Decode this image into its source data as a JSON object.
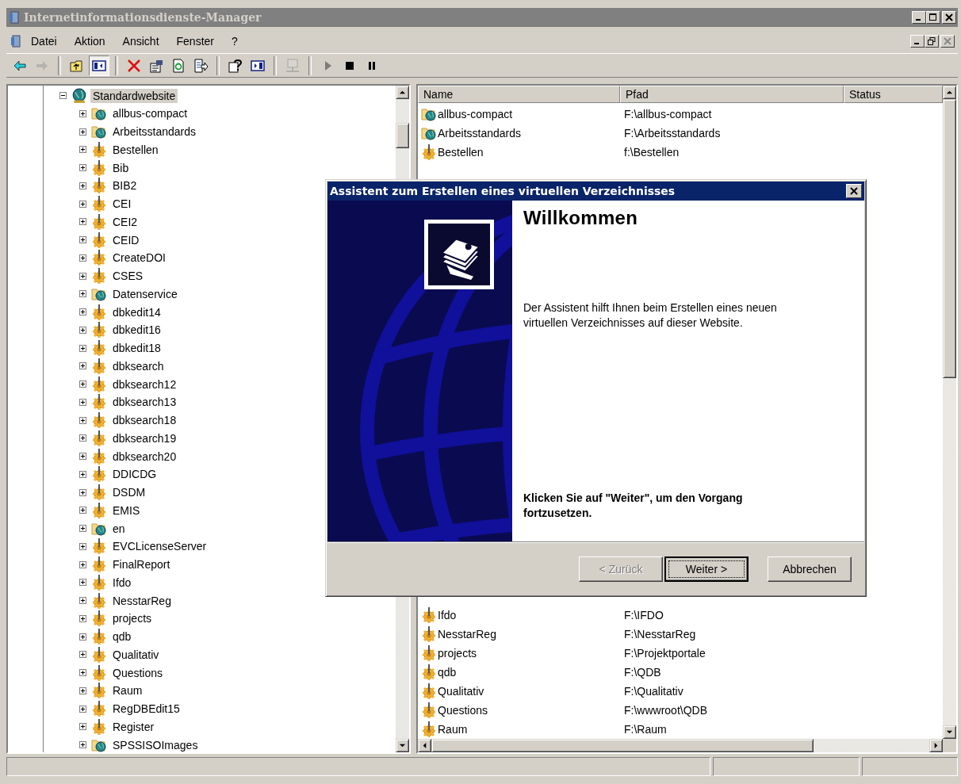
{
  "window": {
    "title": "Internetinformationsdienste-Manager"
  },
  "menu": [
    "Datei",
    "Aktion",
    "Ansicht",
    "Fenster",
    "?"
  ],
  "toolbar": [
    {
      "buttons": [
        {
          "kind": "back",
          "disabled": false,
          "pressed": false
        },
        {
          "kind": "forward",
          "disabled": true,
          "pressed": false
        }
      ]
    },
    {
      "buttons": [
        {
          "kind": "up",
          "disabled": false,
          "pressed": false
        },
        {
          "kind": "tree",
          "disabled": false,
          "pressed": true
        }
      ]
    },
    {
      "buttons": [
        {
          "kind": "delete",
          "disabled": false,
          "pressed": false
        },
        {
          "kind": "properties",
          "disabled": false,
          "pressed": false
        },
        {
          "kind": "refresh",
          "disabled": false,
          "pressed": false
        },
        {
          "kind": "export",
          "disabled": false,
          "pressed": false
        }
      ]
    },
    {
      "buttons": [
        {
          "kind": "help",
          "disabled": false,
          "pressed": false
        },
        {
          "kind": "pane",
          "disabled": false,
          "pressed": false
        }
      ]
    },
    {
      "buttons": [
        {
          "kind": "computer",
          "disabled": true,
          "pressed": false
        }
      ]
    },
    {
      "buttons": [
        {
          "kind": "play",
          "disabled": true,
          "pressed": false
        },
        {
          "kind": "stop",
          "disabled": false,
          "pressed": false
        },
        {
          "kind": "pause",
          "disabled": false,
          "pressed": false
        }
      ]
    }
  ],
  "tree": {
    "label": "Standardwebsite",
    "expanded": true,
    "selected": true,
    "children": [
      {
        "label": "allbus-compact",
        "kind": "site",
        "expanded": false,
        "selected": false
      },
      {
        "label": "Arbeitsstandards",
        "kind": "site",
        "expanded": false,
        "selected": false
      },
      {
        "label": "Bestellen",
        "kind": "app",
        "expanded": false,
        "selected": false
      },
      {
        "label": "Bib",
        "kind": "app",
        "expanded": false,
        "selected": false
      },
      {
        "label": "BIB2",
        "kind": "app",
        "expanded": false,
        "selected": false
      },
      {
        "label": "CEI",
        "kind": "app",
        "expanded": false,
        "selected": false
      },
      {
        "label": "CEI2",
        "kind": "app",
        "expanded": false,
        "selected": false
      },
      {
        "label": "CEID",
        "kind": "app",
        "expanded": false,
        "selected": false
      },
      {
        "label": "CreateDOI",
        "kind": "app",
        "expanded": false,
        "selected": false
      },
      {
        "label": "CSES",
        "kind": "app",
        "expanded": false,
        "selected": false
      },
      {
        "label": "Datenservice",
        "kind": "site",
        "expanded": false,
        "selected": false
      },
      {
        "label": "dbkedit14",
        "kind": "app",
        "expanded": false,
        "selected": false
      },
      {
        "label": "dbkedit16",
        "kind": "app",
        "expanded": false,
        "selected": false
      },
      {
        "label": "dbkedit18",
        "kind": "app",
        "expanded": false,
        "selected": false
      },
      {
        "label": "dbksearch",
        "kind": "app",
        "expanded": false,
        "selected": false
      },
      {
        "label": "dbksearch12",
        "kind": "app",
        "expanded": false,
        "selected": false
      },
      {
        "label": "dbksearch13",
        "kind": "app",
        "expanded": false,
        "selected": false
      },
      {
        "label": "dbksearch18",
        "kind": "app",
        "expanded": false,
        "selected": false
      },
      {
        "label": "dbksearch19",
        "kind": "app",
        "expanded": false,
        "selected": false
      },
      {
        "label": "dbksearch20",
        "kind": "app",
        "expanded": false,
        "selected": false
      },
      {
        "label": "DDICDG",
        "kind": "app",
        "expanded": false,
        "selected": false
      },
      {
        "label": "DSDM",
        "kind": "app",
        "expanded": false,
        "selected": false
      },
      {
        "label": "EMIS",
        "kind": "app",
        "expanded": false,
        "selected": false
      },
      {
        "label": "en",
        "kind": "site",
        "expanded": false,
        "selected": false
      },
      {
        "label": "EVCLicenseServer",
        "kind": "app",
        "expanded": false,
        "selected": false
      },
      {
        "label": "FinalReport",
        "kind": "app",
        "expanded": false,
        "selected": false
      },
      {
        "label": "Ifdo",
        "kind": "app",
        "expanded": false,
        "selected": false
      },
      {
        "label": "NesstarReg",
        "kind": "app",
        "expanded": false,
        "selected": false
      },
      {
        "label": "projects",
        "kind": "app",
        "expanded": false,
        "selected": false
      },
      {
        "label": "qdb",
        "kind": "app",
        "expanded": false,
        "selected": false
      },
      {
        "label": "Qualitativ",
        "kind": "app",
        "expanded": false,
        "selected": false
      },
      {
        "label": "Questions",
        "kind": "app",
        "expanded": false,
        "selected": false
      },
      {
        "label": "Raum",
        "kind": "app",
        "expanded": false,
        "selected": false
      },
      {
        "label": "RegDBEdit15",
        "kind": "app",
        "expanded": false,
        "selected": false
      },
      {
        "label": "Register",
        "kind": "app",
        "expanded": false,
        "selected": false
      },
      {
        "label": "SPSSISOImages",
        "kind": "site",
        "expanded": false,
        "selected": false
      }
    ]
  },
  "list": {
    "columns": [
      "Name",
      "Pfad",
      "Status"
    ],
    "rows_top": [
      {
        "name": "allbus-compact",
        "path": "F:\\allbus-compact",
        "kind": "site"
      },
      {
        "name": "Arbeitsstandards",
        "path": "F:\\Arbeitsstandards",
        "kind": "site"
      },
      {
        "name": "Bestellen",
        "path": "f:\\Bestellen",
        "kind": "app"
      }
    ],
    "rows_bottom": [
      {
        "name": "Ifdo",
        "path": "F:\\IFDO",
        "kind": "app"
      },
      {
        "name": "NesstarReg",
        "path": "F:\\NesstarReg",
        "kind": "app"
      },
      {
        "name": "projects",
        "path": "F:\\Projektportale",
        "kind": "app"
      },
      {
        "name": "qdb",
        "path": "F:\\QDB",
        "kind": "app"
      },
      {
        "name": "Qualitativ",
        "path": "F:\\Qualitativ",
        "kind": "app"
      },
      {
        "name": "Questions",
        "path": "F:\\wwwroot\\QDB",
        "kind": "app"
      },
      {
        "name": "Raum",
        "path": "F:\\Raum",
        "kind": "app"
      }
    ]
  },
  "dialog": {
    "title": "Assistent zum Erstellen eines virtuellen Verzeichnisses",
    "heading": "Willkommen",
    "text": "Der Assistent hilft Ihnen beim Erstellen eines neuen virtuellen Verzeichnisses auf dieser Website.",
    "instruction": "Klicken Sie auf \"Weiter\", um den Vorgang fortzusetzen.",
    "buttons": [
      {
        "label": "< Zurück",
        "disabled": true,
        "default": false
      },
      {
        "label": "Weiter >",
        "disabled": false,
        "default": true
      },
      {
        "label": "Abbrechen",
        "disabled": false,
        "default": false
      }
    ]
  }
}
